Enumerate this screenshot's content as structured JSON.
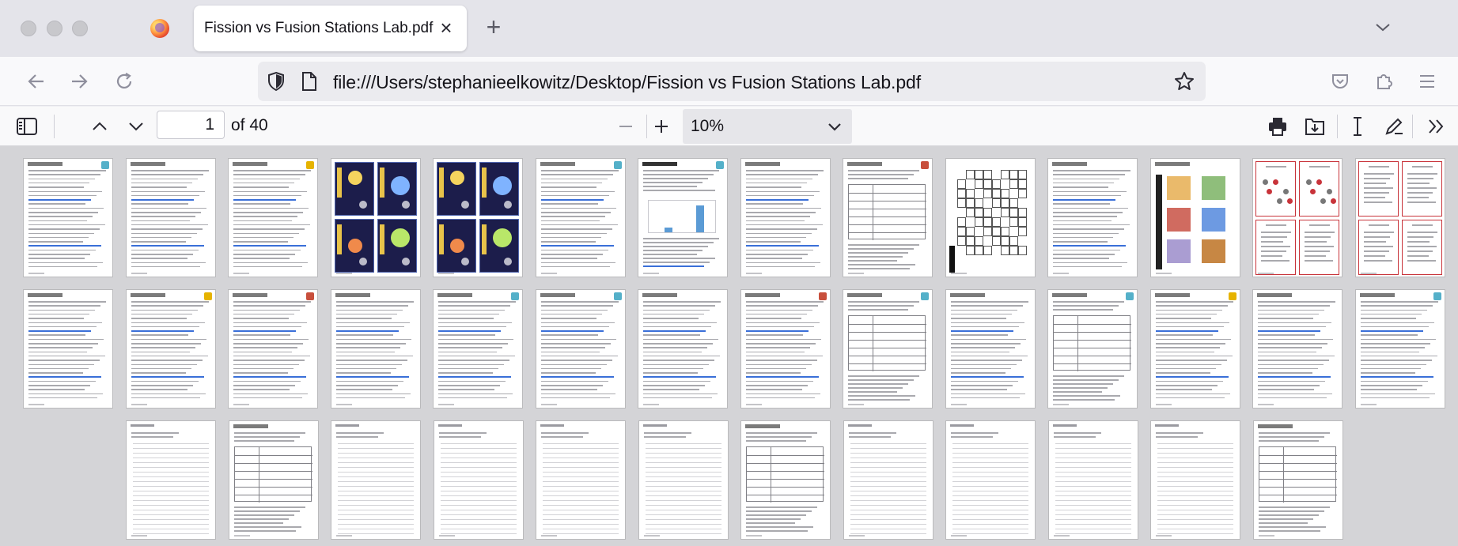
{
  "window": {
    "tab_title": "Fission vs Fusion Stations Lab.pdf",
    "url": "file:///Users/stephanieelkowitz/Desktop/Fission vs Fusion Stations Lab.pdf"
  },
  "pdf_toolbar": {
    "page_number": "1",
    "page_count": "of 40",
    "zoom": "10%"
  },
  "thumbnails": {
    "total_pages": 40,
    "rows": [
      [
        "text",
        "text",
        "text",
        "poster",
        "poster",
        "text",
        "chart",
        "text",
        "table",
        "puzzle",
        "text",
        "diagram",
        "cards",
        "cards"
      ],
      [
        "text",
        "text",
        "text",
        "text",
        "text",
        "text",
        "text",
        "text",
        "table",
        "text",
        "table",
        "text",
        "text",
        "text"
      ],
      [
        "lines",
        "table",
        "lines",
        "lines",
        "lines",
        "lines",
        "table",
        "lines",
        "lines",
        "lines",
        "lines",
        "table"
      ]
    ]
  },
  "colors": {
    "tabstrip": "#e4e4ea",
    "toolbar": "#f9f9fb",
    "viewer": "#d4d4d7",
    "link_blue": "#3a6fd8",
    "poster_navy": "#1c1d4b",
    "card_red": "#c8333a"
  },
  "icons": [
    "firefox-logo",
    "close-icon",
    "plus-icon",
    "chevron-down-icon",
    "back-arrow-icon",
    "forward-arrow-icon",
    "reload-icon",
    "shield-icon",
    "page-icon",
    "star-icon",
    "pocket-icon",
    "extensions-icon",
    "menu-icon",
    "sidebar-toggle-icon",
    "chevron-up-icon",
    "minus-icon",
    "print-icon",
    "save-icon",
    "text-cursor-icon",
    "pen-icon",
    "double-chevron-icon"
  ]
}
